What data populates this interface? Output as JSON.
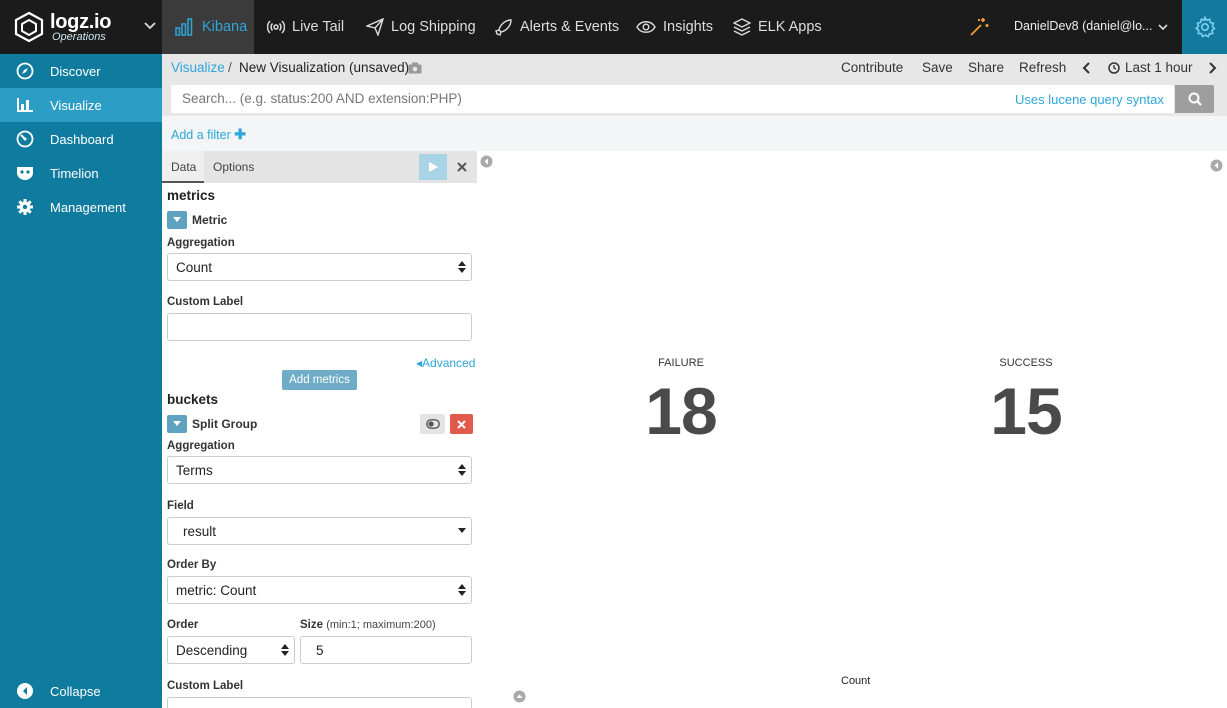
{
  "brand": {
    "name": "logz.io",
    "subtitle": "Operations"
  },
  "topnav": {
    "items": [
      {
        "label": "Kibana",
        "icon": "bar-chart-icon"
      },
      {
        "label": "Live Tail",
        "icon": "broadcast-icon"
      },
      {
        "label": "Log Shipping",
        "icon": "paper-plane-icon"
      },
      {
        "label": "Alerts & Events",
        "icon": "rocket-icon"
      },
      {
        "label": "Insights",
        "icon": "eye-icon"
      },
      {
        "label": "ELK Apps",
        "icon": "layers-icon"
      }
    ],
    "user": "DanielDev8 (daniel@lo..."
  },
  "sidebar": {
    "items": [
      {
        "label": "Discover",
        "icon": "compass-icon"
      },
      {
        "label": "Visualize",
        "icon": "bar-chart-icon"
      },
      {
        "label": "Dashboard",
        "icon": "gauge-icon"
      },
      {
        "label": "Timelion",
        "icon": "mask-icon"
      },
      {
        "label": "Management",
        "icon": "gear-icon"
      }
    ],
    "collapse": "Collapse"
  },
  "breadcrumb": {
    "link": "Visualize",
    "separator": "/",
    "title": "New Visualization (unsaved)"
  },
  "menu": {
    "contribute": "Contribute",
    "save": "Save",
    "share": "Share",
    "refresh": "Refresh",
    "time_range": "Last 1 hour"
  },
  "query": {
    "placeholder": "Search... (e.g. status:200 AND extension:PHP)",
    "syntax_link": "Uses lucene query syntax"
  },
  "filter": {
    "add": "Add a filter"
  },
  "editor": {
    "tabs": {
      "data": "Data",
      "options": "Options"
    },
    "metrics": {
      "section": "metrics",
      "agg_title": "Metric",
      "aggregation_label": "Aggregation",
      "aggregation_value": "Count",
      "custom_label": "Custom Label",
      "advanced": "Advanced",
      "add_button": "Add metrics"
    },
    "buckets": {
      "section": "buckets",
      "agg_title": "Split Group",
      "aggregation_label": "Aggregation",
      "aggregation_value": "Terms",
      "field_label": "Field",
      "field_value": "result",
      "order_by_label": "Order By",
      "order_by_value": "metric: Count",
      "order_label": "Order",
      "order_value": "Descending",
      "size_label": "Size",
      "size_hint": "(min:1; maximum:200)",
      "size_value": "5",
      "custom_label": "Custom Label"
    }
  },
  "visualization": {
    "metrics": [
      {
        "label": "FAILURE",
        "value": "18"
      },
      {
        "label": "SUCCESS",
        "value": "15"
      }
    ],
    "axis_label": "Count"
  },
  "colors": {
    "topbar": "#1b1b1b",
    "sidebar": "#0f7b9f",
    "accent": "#2ea6d9",
    "danger": "#e25a4b"
  }
}
